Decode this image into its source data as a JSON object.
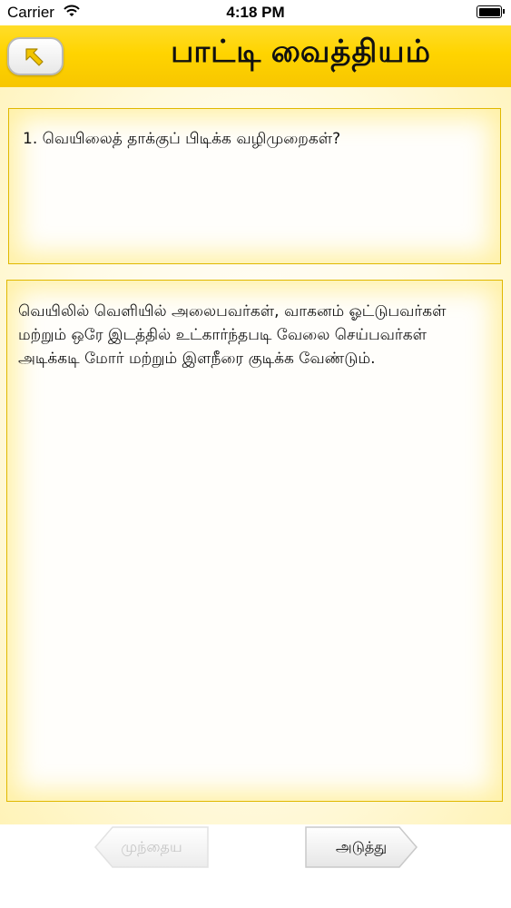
{
  "status_bar": {
    "carrier": "Carrier",
    "time": "4:18 PM"
  },
  "header": {
    "title": "பாட்டி வைத்தியம்",
    "back_icon": "arrow-up-left-icon"
  },
  "question": {
    "text": "1. வெயிலைத் தாக்குப் பிடிக்க வழிமுறைகள்?"
  },
  "answer": {
    "text": "வெயிலில் வெளியில் அலைபவர்கள், வாகனம் ஓட்டுபவர்கள் மற்றும் ஒரே இடத்தில் உட்கார்ந்தபடி வேலை செய்பவர்கள் அடிக்கடி மோர் மற்றும் இளநீரை குடிக்க வேண்டும்."
  },
  "navigation": {
    "prev_label": "முந்தைய",
    "next_label": "அடுத்து",
    "prev_enabled": false,
    "next_enabled": true
  },
  "colors": {
    "header_yellow": "#ffd400",
    "card_border": "#e0b800"
  }
}
